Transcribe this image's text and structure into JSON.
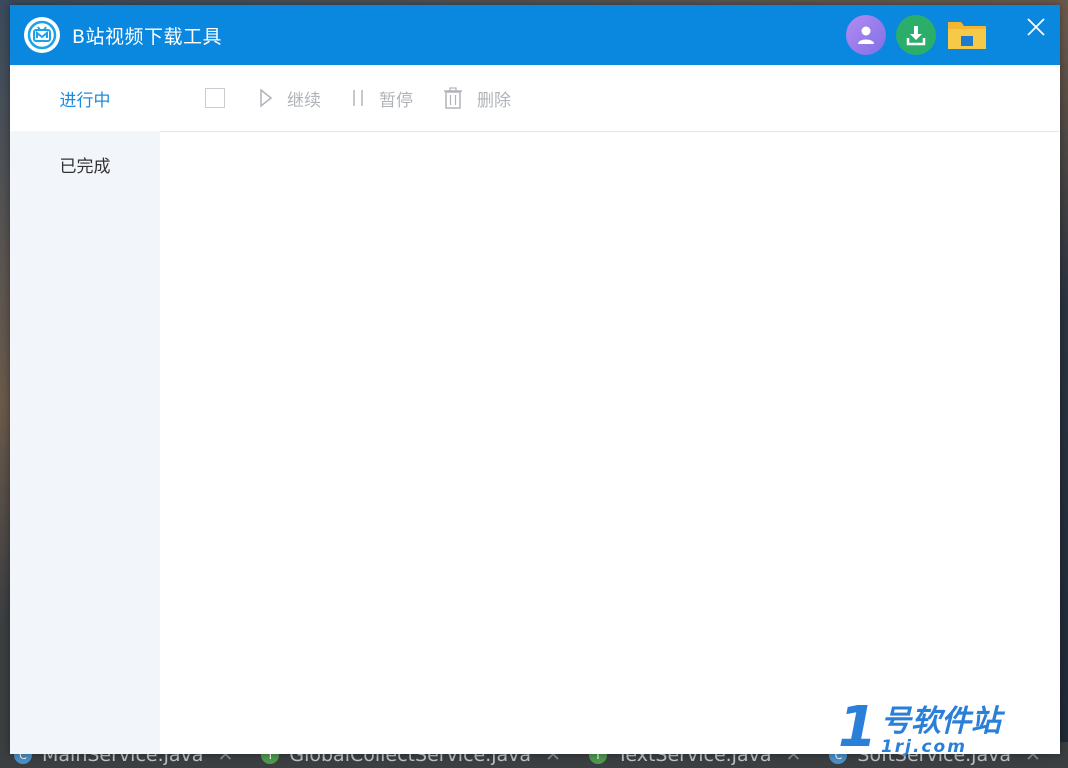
{
  "window": {
    "title": "B站视频下载工具"
  },
  "sidebar": {
    "items": [
      {
        "label": "进行中",
        "active": true
      },
      {
        "label": "已完成",
        "active": false
      }
    ]
  },
  "toolbar": {
    "continue_label": "继续",
    "pause_label": "暂停",
    "delete_label": "删除"
  },
  "background_tabs": [
    {
      "label": "MainService.java",
      "badge": "C",
      "color": "#4a90c8"
    },
    {
      "label": "GlobalCollectService.java",
      "badge": "I",
      "color": "#4e9a4e"
    },
    {
      "label": "TextService.java",
      "badge": "I",
      "color": "#4e9a4e"
    },
    {
      "label": "SoftService.java",
      "badge": "C",
      "color": "#4a90c8"
    }
  ],
  "watermark": {
    "number": "1",
    "name": "号软件站",
    "url": "1rj.com"
  },
  "colors": {
    "titlebar": "#0a87de",
    "active_tab": "#1d8ce0",
    "sidebar": "#f2f5fa"
  }
}
